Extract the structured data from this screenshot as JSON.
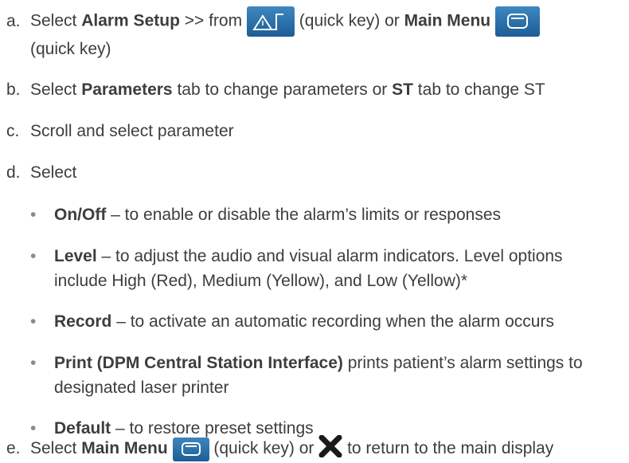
{
  "steps": {
    "a": {
      "letter": "a.",
      "t1": "Select ",
      "b1": "Alarm Setup",
      "t2": " >> from ",
      "t3": " (quick key) or ",
      "b2": "Main Menu",
      "t4": "(quick key)"
    },
    "b": {
      "letter": "b.",
      "t1": "Select ",
      "b1": "Parameters",
      "t2": " tab to change parameters or ",
      "b2": "ST",
      "t3": " tab to change ST"
    },
    "c": {
      "letter": "c.",
      "text": "Scroll and select parameter"
    },
    "d": {
      "letter": "d.",
      "text": "Select",
      "bullets": [
        {
          "bold": "On/Off",
          "text": " – to enable or disable the alarm’s limits or responses"
        },
        {
          "bold": "Level",
          "text": " – to adjust the audio and visual alarm indicators. Level options",
          "cont": "include High (Red), Medium (Yellow), and Low (Yellow)*"
        },
        {
          "bold": "Record",
          "text": " – to activate an automatic recording when the alarm occurs"
        },
        {
          "bold": "Print (DPM Central Station Interface)",
          "text": " prints patient’s alarm settings to",
          "cont": "designated laser printer"
        },
        {
          "bold": "Default",
          "text": " – to restore preset settings"
        }
      ]
    },
    "e": {
      "letter": "e.",
      "t1": "Select ",
      "b1": "Main Menu",
      "t2": " (quick key) or ",
      "t3": " to return to the main display"
    }
  },
  "icons": {
    "alarm_setup_key": "alarm-setup-quick-key-icon",
    "main_menu_key": "main-menu-quick-key-icon",
    "close": "close-x-icon"
  },
  "colors": {
    "key_blue": "#2a6fa9",
    "text": "#3d3d3d"
  }
}
